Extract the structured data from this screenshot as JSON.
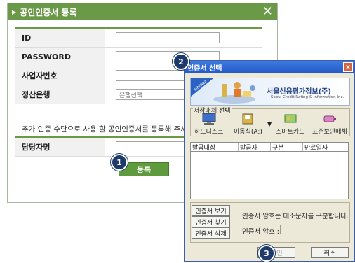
{
  "register_dialog": {
    "title": "공인인증서 등록",
    "close_glyph": "✕",
    "fields": [
      {
        "label": "ID",
        "value": ""
      },
      {
        "label": "PASSWORD",
        "value": ""
      },
      {
        "label": "사업자번호",
        "value": ""
      },
      {
        "label": "정산은행",
        "placeholder": "은행선택"
      }
    ],
    "note": "추가 인증 수단으로 사용 할 공인인증서를 등록해 주세요.",
    "manager_label": "담당자명",
    "register_button": "등록"
  },
  "steps": [
    "1",
    "2",
    "3"
  ],
  "cert_window": {
    "title": "인증서 선택",
    "close_glyph": "×",
    "banner": {
      "company": "서울신용평가정보(주)",
      "company_en": "Seoul Credit Rating & Information Inc.",
      "logo_text": "SIREN24"
    },
    "media_legend": "저장매체 선택",
    "media": [
      "하드디스크",
      "이동식(A:)",
      "스마트카드",
      "표준보안매체"
    ],
    "dropdown_glyph": "▼",
    "table_headers": [
      "발급대상",
      "발급자",
      "구분",
      "만료일자"
    ],
    "side_buttons": [
      "인증서 보기",
      "인증서 찾기",
      "인증서 삭제"
    ],
    "password_note": "인증서 암호는 대소문자를 구분합니다.",
    "password_label": "인증서 암호 :",
    "ok_button": "확인",
    "cancel_button": "취소"
  },
  "colors": {
    "green": "#6a9a47",
    "button_green": "#5f9b3c",
    "badge_navy": "#1e3a6b",
    "xp_blue": "#2459c8"
  }
}
